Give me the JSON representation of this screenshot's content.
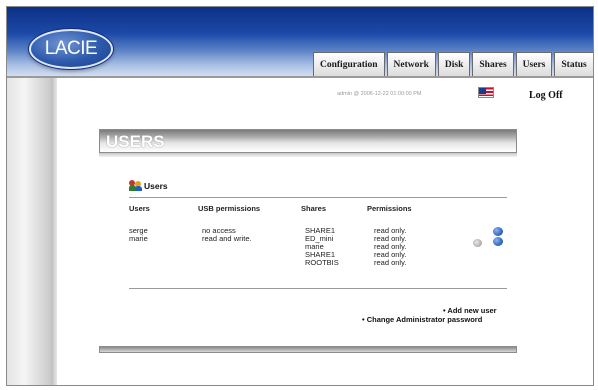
{
  "header": {
    "logo_text": "LACIE",
    "tabs": [
      "Configuration",
      "Network",
      "Disk",
      "Shares",
      "Users",
      "Status"
    ]
  },
  "status_bar": {
    "session_text": "admin @ 2006-12-22 01:00:00 PM",
    "logoff_label": "Log Off"
  },
  "page": {
    "title": "USERS"
  },
  "users_section": {
    "heading": "Users",
    "columns": {
      "users": "Users",
      "usb_permissions": "USB permissions",
      "shares": "Shares",
      "permissions": "Permissions"
    },
    "rows": [
      {
        "user": "serge",
        "usb_permission": "no access",
        "shares": [
          "SHARE1"
        ],
        "permissions": [
          "read only."
        ]
      },
      {
        "user": "marie",
        "usb_permission": "read and write.",
        "shares": [
          "ED_mini",
          "marie",
          "SHARE1",
          "ROOTBIS"
        ],
        "permissions": [
          "read only.",
          "read only.",
          "read only.",
          "read only."
        ]
      }
    ]
  },
  "actions": {
    "add_user": "• Add new user",
    "change_admin_password": "• Change Administrator password"
  },
  "colors": {
    "header_top": "#0d2f86",
    "header_bottom": "#d6e1f2",
    "edit_icon": "#3b6fc8"
  }
}
